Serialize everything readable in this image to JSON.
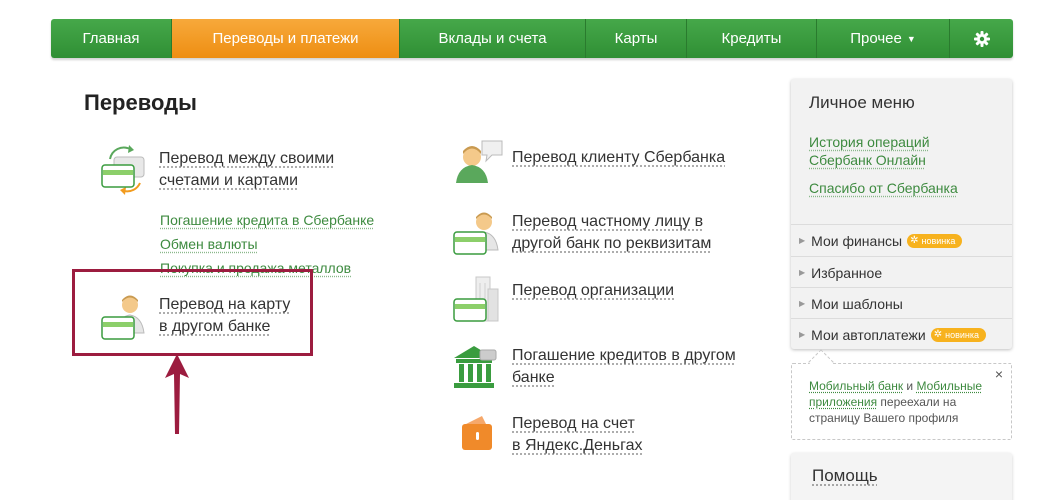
{
  "nav": {
    "items": [
      {
        "label": "Главная"
      },
      {
        "label": "Переводы и платежи"
      },
      {
        "label": "Вклады и счета"
      },
      {
        "label": "Карты"
      },
      {
        "label": "Кредиты"
      },
      {
        "label": "Прочее"
      }
    ],
    "settings_icon": "gear-icon",
    "active_color": "#f29b1e",
    "base_color": "#3a9c3f"
  },
  "main": {
    "title": "Переводы",
    "left": {
      "own_transfer": {
        "line1": "Перевод между своими",
        "line2": "счетами и картами"
      },
      "sublinks": [
        "Погашение кредита в Сбербанке",
        "Обмен валюты",
        "Покупка и продажа металлов"
      ],
      "card_transfer": {
        "line1": "Перевод на карту",
        "line2": "в другом банке"
      }
    },
    "right": {
      "client": {
        "line1": "Перевод клиенту Сбербанка"
      },
      "private": {
        "line1": "Перевод частному лицу в",
        "line2": "другой банк по реквизитам"
      },
      "org": {
        "line1": "Перевод организации"
      },
      "loan": {
        "line1": "Погашение кредитов в другом",
        "line2": "банке"
      },
      "yandex": {
        "line1": "Перевод на счет",
        "line2": "в Яндекс.Деньгах"
      }
    },
    "highlight_color": "#9c1c3f"
  },
  "sidebar": {
    "title": "Личное меню",
    "links": [
      {
        "line1": "История операций",
        "line2": "Сбербанк Онлайн"
      },
      {
        "line1": "Спасибо от Сбербанка"
      }
    ],
    "rows": [
      {
        "label": "Мои финансы",
        "badge": "новинка"
      },
      {
        "label": "Избранное"
      },
      {
        "label": "Мои шаблоны"
      },
      {
        "label": "Мои автоплатежи",
        "badge": "новинка"
      }
    ]
  },
  "notice": {
    "link1": "Мобильный банк",
    "and": " и ",
    "link2": "Мобильные приложения",
    "rest": " переехали на страницу Вашего профиля",
    "close": "×"
  },
  "help": {
    "title": "Помощь"
  }
}
